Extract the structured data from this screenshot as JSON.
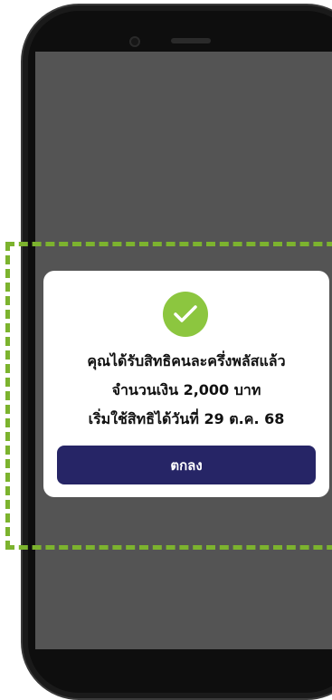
{
  "dialog": {
    "line1": "คุณได้รับสิทธิคนละครึ่งพลัสแล้ว",
    "line2": "จำนวนเงิน 2,000 บาท",
    "line3": "เริ่มใช้สิทธิได้วันที่ 29 ต.ค. 68",
    "ok_label": "ตกลง"
  },
  "icons": {
    "success": "check-circle-icon"
  },
  "colors": {
    "success_green": "#8cc63f",
    "button_navy": "#262566",
    "highlight_green": "#7cb32e",
    "overlay_gray": "#545454"
  }
}
